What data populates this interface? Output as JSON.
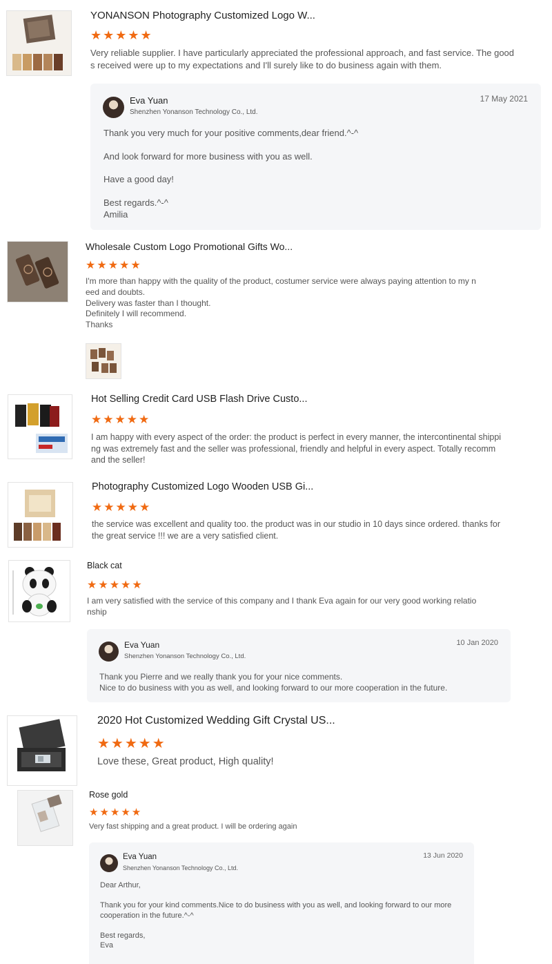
{
  "reviews": [
    {
      "title": "YONANSON Photography Customized Logo W...",
      "stars": "★★★★★",
      "text": "Very reliable supplier. I have particularly appreciated the professional approach, and fast service. The good\ns received were up to my expectations and I'll surely like to do business again with them.",
      "thumb_icon": "wooden-usb-box-set-image",
      "reply": {
        "name": "Eva Yuan",
        "company": "Shenzhen Yonanson Technology Co., Ltd.",
        "date": "17 May 2021",
        "body": "Thank you very much for your positive comments,dear friend.^-^\n\nAnd look forward for more business with you as well.\n\nHave a good day!\n\nBest regards.^-^\nAmilia"
      }
    },
    {
      "title": "Wholesale Custom Logo Promotional Gifts Wo...",
      "stars": "★★★★★",
      "text": "I'm more than happy with the quality of the product, costumer service were always paying attention to my n\need and doubts.\nDelivery  was faster than I thought.\nDefinitely I will recommend.\nThanks",
      "thumb_icon": "engraved-wooden-usb-image",
      "photo_icon": "customer-photo-wooden-usb"
    },
    {
      "title": "Hot Selling Credit Card USB Flash Drive Custo...",
      "stars": "★★★★★",
      "text": "I am happy with every aspect of the order: the product is perfect in every manner, the intercontinental shippi\nng was extremely fast and the seller was professional, friendly and helpful in every aspect. Totally recomm\nand the seller!",
      "thumb_icon": "credit-card-usb-image"
    },
    {
      "title": "Photography Customized Logo Wooden USB Gi...",
      "stars": "★★★★★",
      "text": "the service was excellent and quality too. the product was in our studio in 10 days since ordered. thanks for\nthe great service !!! we are a very satisfied client.",
      "thumb_icon": "wooden-box-usb-set-image"
    },
    {
      "title": "Black cat",
      "stars": "★★★★★",
      "text": "I am very satisfied with the service of this company and I thank Eva again for our very good working relatio\nnship",
      "thumb_icon": "panda-usb-image",
      "reply": {
        "name": "Eva Yuan",
        "company": "Shenzhen Yonanson Technology Co., Ltd.",
        "date": "10 Jan 2020",
        "body": "Thank you Pierre and we really thank you for your nice comments.\nNice to do business with you as well, and looking forward to our more cooperation in the future."
      }
    },
    {
      "title": "2020 Hot Customized Wedding Gift Crystal US...",
      "stars": "★★★★★",
      "text": "Love these, Great product, High quality!",
      "thumb_icon": "crystal-usb-gift-box-image"
    },
    {
      "title": "Rose gold",
      "stars": "★★★★★",
      "text": "Very fast shipping and a great product. I will be ordering again",
      "thumb_icon": "crystal-usb-rose-gold-image",
      "reply": {
        "name": "Eva Yuan",
        "company": "Shenzhen Yonanson Technology Co., Ltd.",
        "date": "13 Jun 2020",
        "body": "Dear Arthur,\n\nThank you for your kind comments.Nice to do business with you as well, and looking forward to our more\ncooperation in the future.^-^\n\nBest regards,\nEva"
      }
    }
  ],
  "colors": {
    "star": "#f06a12",
    "reply_bg": "#f5f6f8"
  }
}
